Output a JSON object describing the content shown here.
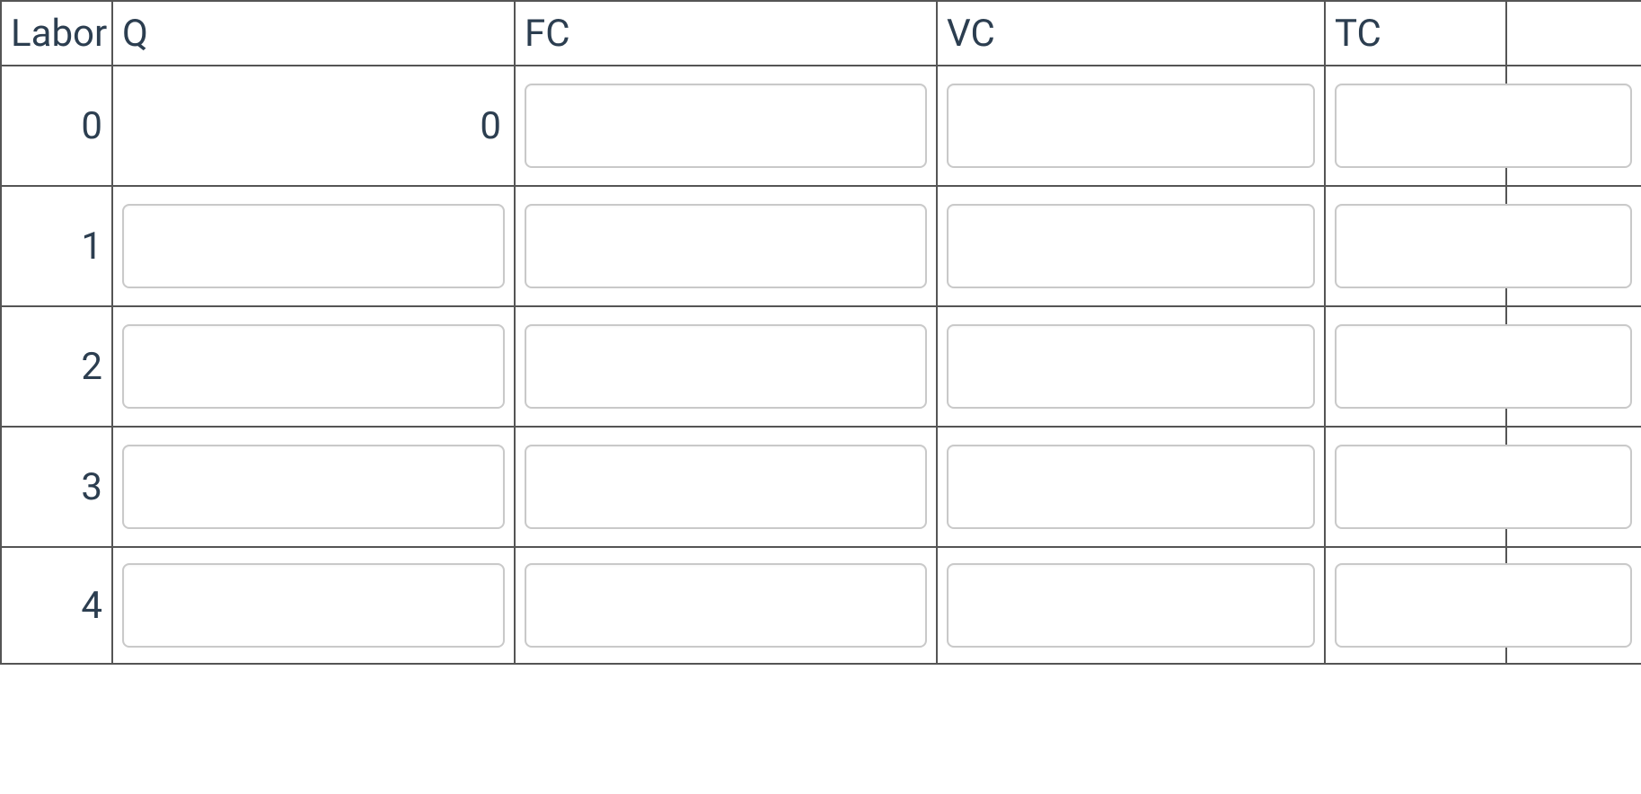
{
  "table": {
    "headers": {
      "labor": "Labor",
      "q": "Q",
      "fc": "FC",
      "vc": "VC",
      "tc": "TC",
      "extra": ""
    },
    "rows": [
      {
        "labor": "0",
        "q_static": "0",
        "q": null,
        "fc": "",
        "vc": "",
        "tc": ""
      },
      {
        "labor": "1",
        "q_static": null,
        "q": "",
        "fc": "",
        "vc": "",
        "tc": ""
      },
      {
        "labor": "2",
        "q_static": null,
        "q": "",
        "fc": "",
        "vc": "",
        "tc": ""
      },
      {
        "labor": "3",
        "q_static": null,
        "q": "",
        "fc": "",
        "vc": "",
        "tc": ""
      },
      {
        "labor": "4",
        "q_static": null,
        "q": "",
        "fc": "",
        "vc": "",
        "tc": ""
      }
    ]
  }
}
